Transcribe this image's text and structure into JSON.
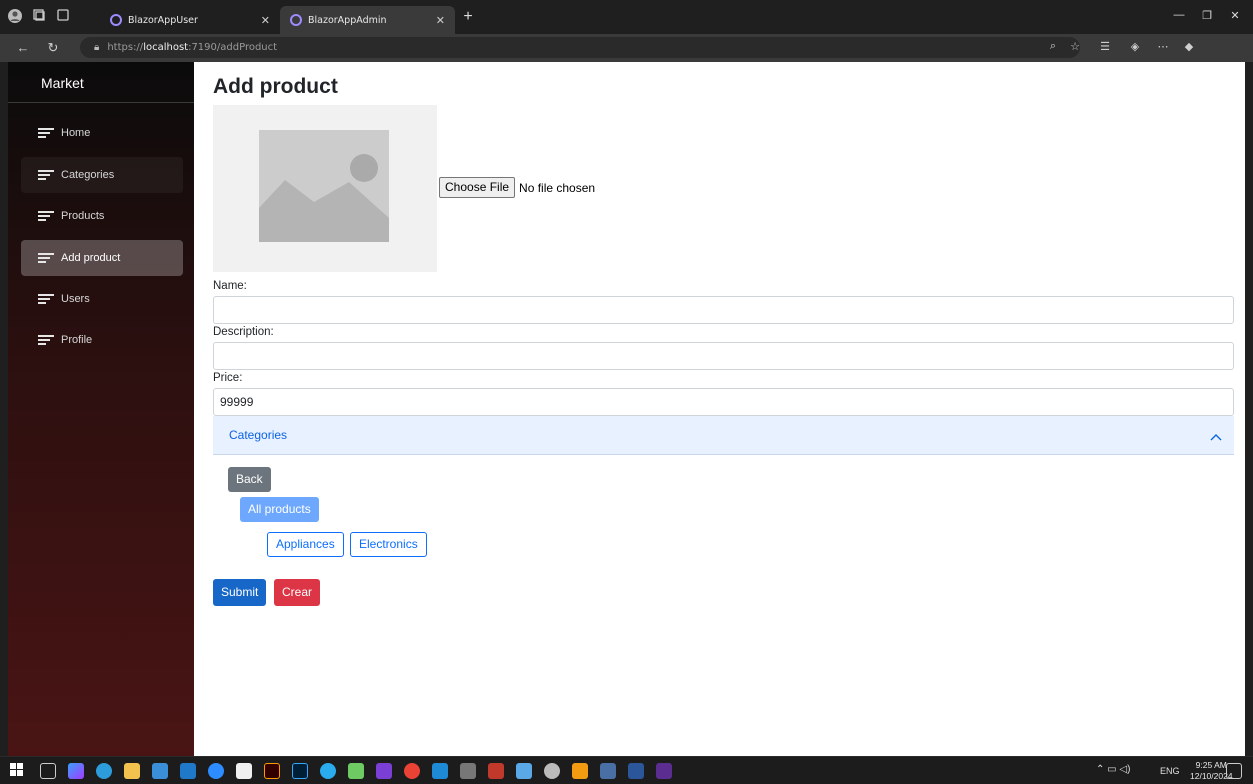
{
  "browser": {
    "tabs": [
      {
        "label": "BlazorAppUser",
        "active": false
      },
      {
        "label": "BlazorAppAdmin",
        "active": true
      }
    ],
    "url_scheme": "https://",
    "url_host": "localhost",
    "url_rest": ":7190/addProduct"
  },
  "sidebar": {
    "brand": "Market",
    "items": [
      {
        "label": "Home"
      },
      {
        "label": "Categories"
      },
      {
        "label": "Products"
      },
      {
        "label": "Add product"
      },
      {
        "label": "Users"
      },
      {
        "label": "Profile"
      }
    ],
    "active_item": "Add product"
  },
  "main": {
    "title": "Add product",
    "file": {
      "button_label": "Choose File",
      "status": "No file chosen"
    },
    "fields": {
      "name_label": "Name:",
      "name_value": "",
      "description_label": "Description:",
      "description_value": "",
      "price_label": "Price:",
      "price_value": "99999"
    },
    "categories": {
      "header": "Categories",
      "back_label": "Back",
      "all_label": "All products",
      "items": [
        "Appliances",
        "Electronics"
      ]
    },
    "actions": {
      "submit_label": "Submit",
      "clear_label": "Crear"
    }
  },
  "taskbar": {
    "language": "ENG",
    "time": "9:25 AM",
    "date": "12/10/2024"
  },
  "colors": {
    "primary": "#0d6efd",
    "danger": "#dc3545",
    "secondary": "#6c757d",
    "accordion_bg": "#e7f1ff"
  }
}
